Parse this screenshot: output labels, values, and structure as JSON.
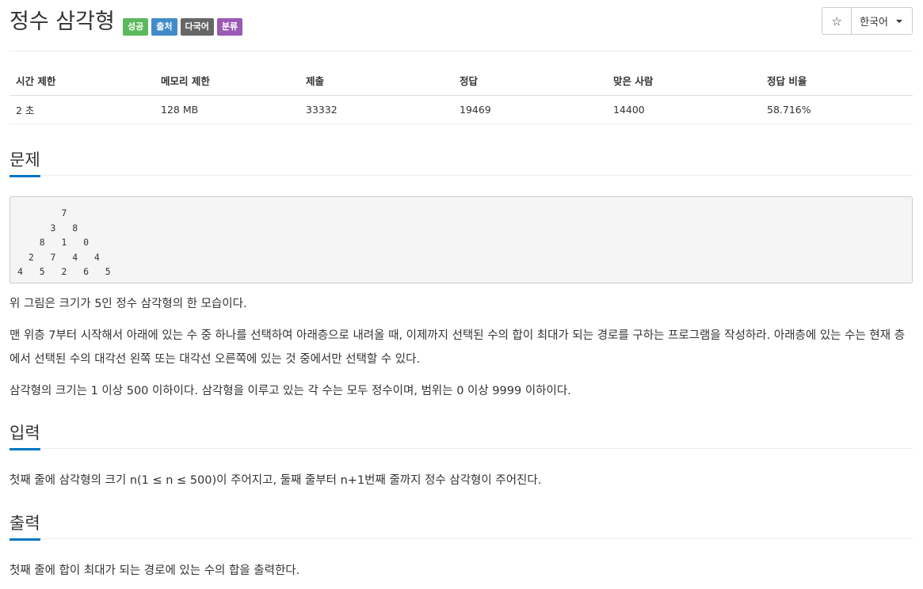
{
  "header": {
    "title": "정수 삼각형",
    "badges": {
      "success": "성공",
      "source": "출처",
      "multilang": "다국어",
      "category": "분류"
    },
    "star_icon": "☆",
    "language": "한국어"
  },
  "stats": {
    "headers": [
      "시간 제한",
      "메모리 제한",
      "제출",
      "정답",
      "맞은 사람",
      "정답 비율"
    ],
    "values": [
      "2 초",
      "128 MB",
      "33332",
      "19469",
      "14400",
      "58.716%"
    ]
  },
  "problem": {
    "heading": "문제",
    "triangle": "        7\n      3   8\n    8   1   0\n  2   7   4   4\n4   5   2   6   5",
    "paragraphs": [
      "위 그림은 크기가 5인 정수 삼각형의 한 모습이다.",
      "맨 위층 7부터 시작해서 아래에 있는 수 중 하나를 선택하여 아래층으로 내려올 때, 이제까지 선택된 수의 합이 최대가 되는 경로를 구하는 프로그램을 작성하라. 아래층에 있는 수는 현재 층에서 선택된 수의 대각선 왼쪽 또는 대각선 오른쪽에 있는 것 중에서만 선택할 수 있다.",
      "삼각형의 크기는 1 이상 500 이하이다. 삼각형을 이루고 있는 각 수는 모두 정수이며, 범위는 0 이상 9999 이하이다."
    ]
  },
  "input": {
    "heading": "입력",
    "text": "첫째 줄에 삼각형의 크기 n(1 ≤ n ≤ 500)이 주어지고, 둘째 줄부터 n+1번째 줄까지 정수 삼각형이 주어진다."
  },
  "output": {
    "heading": "출력",
    "text": "첫째 줄에 합이 최대가 되는 경로에 있는 수의 합을 출력한다."
  }
}
